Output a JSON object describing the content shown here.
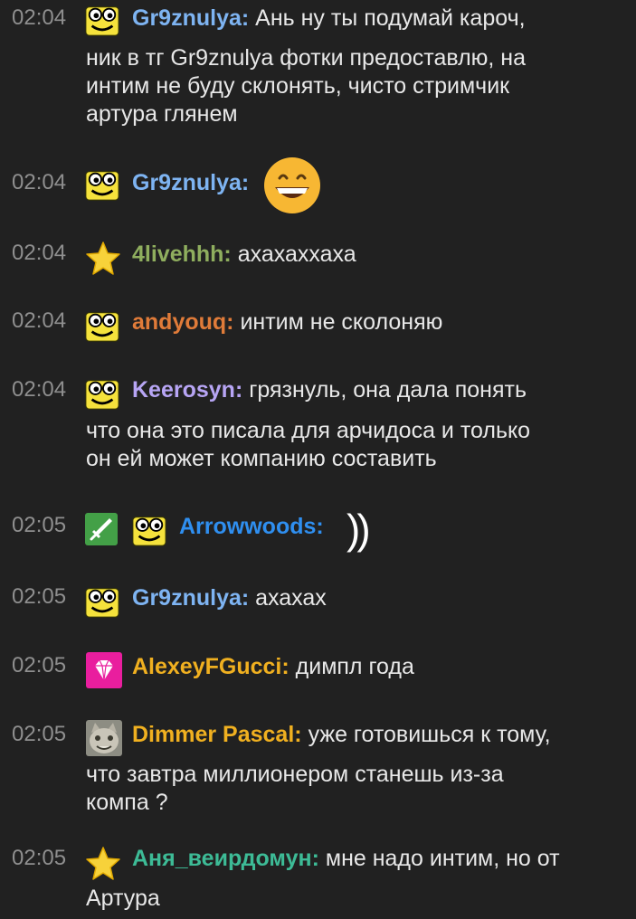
{
  "colors": {
    "background": "#212121",
    "timestamp": "#8f8f8f",
    "text": "#e8e8e8"
  },
  "messages": [
    {
      "time": "02:04",
      "badges": [
        "glasses-smiley-icon"
      ],
      "nick": "Gr9znulya:",
      "nick_color": "#7eb4f2",
      "text": "Ань ну ты подумай кароч,",
      "continuation": [
        "ник в тг Gr9znulya фотки предоставлю, на",
        "интим не буду склонять, чисто стримчик",
        "артура глянем"
      ]
    },
    {
      "time": "02:04",
      "badges": [
        "glasses-smiley-icon"
      ],
      "nick": "Gr9znulya:",
      "nick_color": "#7eb4f2",
      "emoji": "grinning-face-icon",
      "text": "",
      "continuation": []
    },
    {
      "time": "02:04",
      "badges": [
        "star-icon"
      ],
      "nick": "4livehhh:",
      "nick_color": "#8fae5e",
      "text": "ахахаххаха",
      "continuation": []
    },
    {
      "time": "02:04",
      "badges": [
        "glasses-smiley-icon"
      ],
      "nick": "andyouq:",
      "nick_color": "#e07b39",
      "text": "интим не сколоняю",
      "continuation": []
    },
    {
      "time": "02:04",
      "badges": [
        "glasses-smiley-icon"
      ],
      "nick": "Keerosyn:",
      "nick_color": "#b7a5f4",
      "text": "грязнуль, она дала понять",
      "continuation": [
        "что она это писала для арчидоса и только",
        "он ей может компанию составить"
      ]
    },
    {
      "time": "02:05",
      "badges": [
        "sword-icon",
        "glasses-smiley-icon"
      ],
      "nick": "Arrowwoods:",
      "nick_color": "#2f8ff0",
      "text": "))",
      "continuation": []
    },
    {
      "time": "02:05",
      "badges": [
        "glasses-smiley-icon"
      ],
      "nick": "Gr9znulya:",
      "nick_color": "#7eb4f2",
      "text": "ахахах",
      "continuation": []
    },
    {
      "time": "02:05",
      "badges": [
        "gem-icon"
      ],
      "nick": "AlexeyFGucci:",
      "nick_color": "#f0b020",
      "text": "димпл года",
      "continuation": []
    },
    {
      "time": "02:05",
      "badges": [
        "cat-avatar-icon"
      ],
      "nick": "Dimmer Pascal:",
      "nick_color": "#f0b020",
      "text": "уже готовишься к тому,",
      "continuation": [
        "что завтра миллионером станешь из-за",
        "компа ?"
      ]
    },
    {
      "time": "02:05",
      "badges": [
        "star-icon"
      ],
      "nick": "Аня_веирдомун:",
      "nick_color": "#3dbb96",
      "text": "мне надо интим, но от",
      "continuation": [
        "Артура"
      ]
    }
  ]
}
